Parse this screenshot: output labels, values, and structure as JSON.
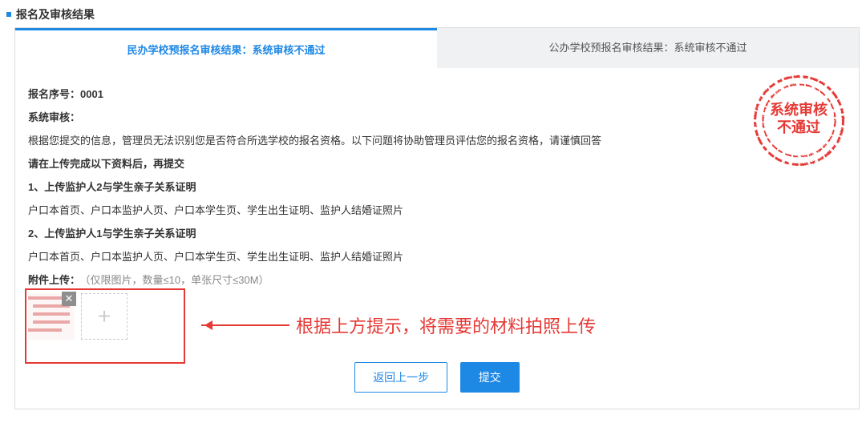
{
  "section": {
    "title": "报名及审核结果"
  },
  "tabs": {
    "active": "民办学校预报名审核结果：系统审核不通过",
    "inactive": "公办学校预报名审核结果：系统审核不通过"
  },
  "reg": {
    "seq_label": "报名序号：",
    "seq_value": "0001",
    "audit_label": "系统审核：",
    "audit_desc": "根据您提交的信息，管理员无法识别您是否符合所选学校的报名资格。以下问题将协助管理员评估您的报名资格，请谨慎回答",
    "instruction": "请在上传完成以下资料后，再提交",
    "item1_title": "1、上传监护人2与学生亲子关系证明",
    "item1_desc": "户口本首页、户口本监护人页、户口本学生页、学生出生证明、监护人结婚证照片",
    "item2_title": "2、上传监护人1与学生亲子关系证明",
    "item2_desc": "户口本首页、户口本监护人页、户口本学生页、学生出生证明、监护人结婚证照片"
  },
  "upload": {
    "label": "附件上传：",
    "help": "（仅限图片，数量≤10，单张尺寸≤30M）",
    "close_glyph": "✕",
    "add_glyph": "+"
  },
  "annotation": {
    "text": "根据上方提示，将需要的材料拍照上传"
  },
  "buttons": {
    "back": "返回上一步",
    "submit": "提交"
  },
  "stamp": {
    "line1": "系统审核",
    "line2": "不通过"
  }
}
